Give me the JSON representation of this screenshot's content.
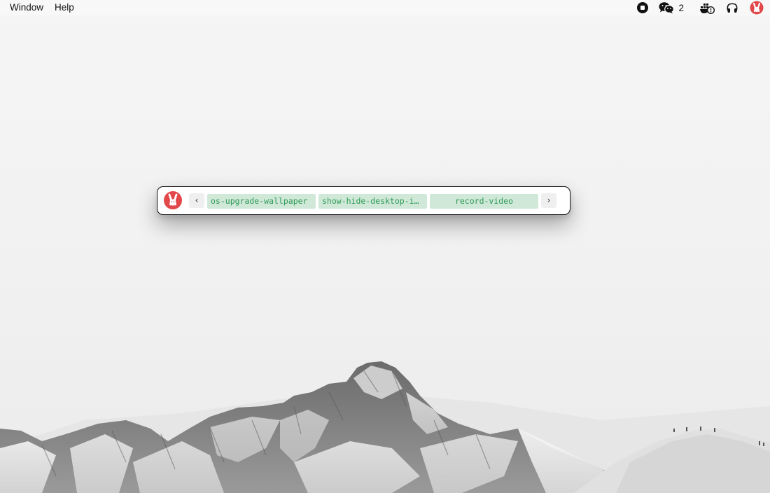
{
  "menubar": {
    "items": [
      {
        "label": "Window"
      },
      {
        "label": "Help"
      }
    ],
    "tray": {
      "wechat_count": "2",
      "icons": [
        "stop-record-icon",
        "wechat-icon",
        "docker-update-icon",
        "airpods-icon",
        "app-logo-icon"
      ]
    }
  },
  "launcher": {
    "prev_label": "‹",
    "next_label": "›",
    "chips": [
      {
        "label": "os-upgrade-wallpaper"
      },
      {
        "label": "show-hide-desktop-icons"
      },
      {
        "label": "record-video"
      }
    ]
  },
  "colors": {
    "chip_bg": "#cfe8d8",
    "chip_text": "#2e9a55",
    "logo_red": "#e2484a"
  }
}
